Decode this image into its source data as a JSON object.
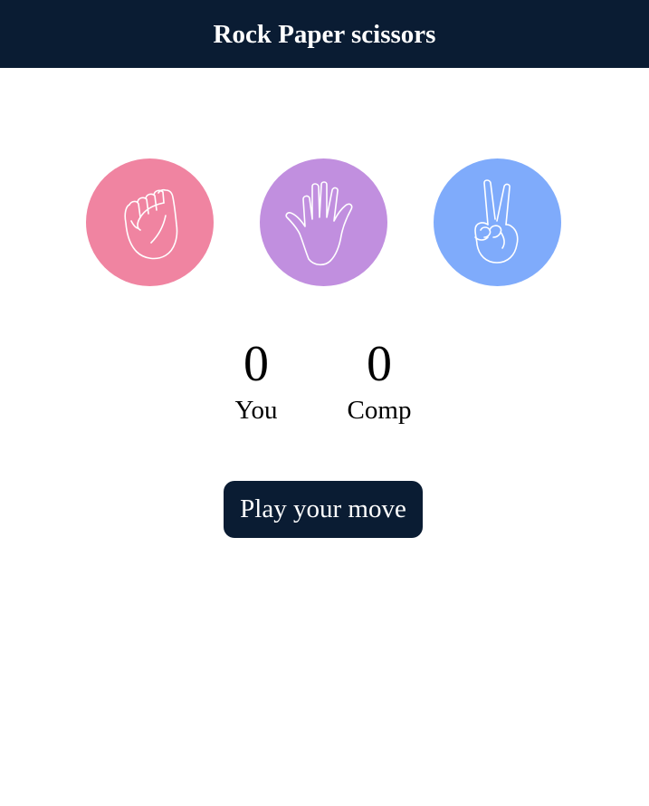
{
  "header": {
    "title": "Rock Paper scissors"
  },
  "choices": [
    {
      "name": "rock",
      "icon": "fist-icon",
      "color": "#f084a1"
    },
    {
      "name": "paper",
      "icon": "open-hand-icon",
      "color": "#c18fdf"
    },
    {
      "name": "scissors",
      "icon": "peace-hand-icon",
      "color": "#7fabfb"
    }
  ],
  "scoreboard": {
    "you": {
      "score": "0",
      "label": "You"
    },
    "comp": {
      "score": "0",
      "label": "Comp"
    }
  },
  "actions": {
    "play_label": "Play your move"
  },
  "theme": {
    "header_bg": "#0a1c33",
    "button_bg": "#0a1c33"
  }
}
